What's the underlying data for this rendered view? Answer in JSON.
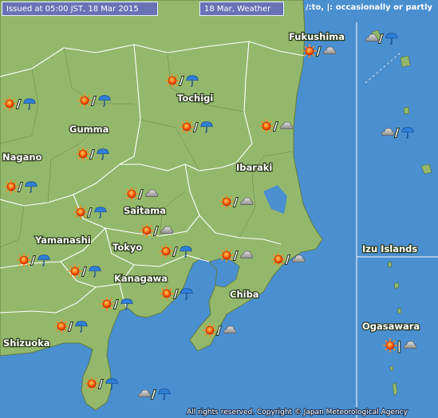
{
  "header": {
    "issued": "Issued at 05:00 JST, 18 Mar 2015",
    "date_label": "18 Mar, Weather",
    "legend": "/:to, |: occasionally or partly"
  },
  "labels": {
    "fukushima": "Fukushima",
    "tochigi": "Tochigi",
    "gumma": "Gumma",
    "nagano": "Nagano",
    "ibaraki": "Ibaraki",
    "saitama": "Saitama",
    "yamanashi": "Yamanashi",
    "tokyo": "Tokyo",
    "kanagawa": "Kanagawa",
    "chiba": "Chiba",
    "shizuoka": "Shizuoka",
    "izu": "Izu Islands",
    "ogasawara": "Ogasawara"
  },
  "footer": "All rights reserved. Copyright © Japan Meteorological Agency",
  "colors": {
    "sea": "#4a8fd0",
    "land": "#93b86b",
    "border": "#ffffff",
    "header_bg": "#6a72b6"
  },
  "forecasts": [
    {
      "area": "Fukushima",
      "from": "sun",
      "sep": "/",
      "to": "cloud"
    },
    {
      "area": "Izu north",
      "from": "cloud",
      "sep": "/",
      "to": "rain"
    },
    {
      "area": "Izu mid",
      "from": "cloud",
      "sep": "/",
      "to": "rain"
    },
    {
      "area": "Nagano north",
      "from": "sun",
      "sep": "/",
      "to": "rain"
    },
    {
      "area": "Gumma north",
      "from": "sun",
      "sep": "/",
      "to": "rain"
    },
    {
      "area": "Tochigi north",
      "from": "sun",
      "sep": "/",
      "to": "rain"
    },
    {
      "area": "Tochigi south",
      "from": "sun",
      "sep": "/",
      "to": "rain"
    },
    {
      "area": "Ibaraki north",
      "from": "sun",
      "sep": "/",
      "to": "cloud"
    },
    {
      "area": "Gumma south",
      "from": "sun",
      "sep": "/",
      "to": "rain"
    },
    {
      "area": "Nagano south",
      "from": "sun",
      "sep": "/",
      "to": "rain"
    },
    {
      "area": "Saitama north",
      "from": "sun",
      "sep": "/",
      "to": "cloud"
    },
    {
      "area": "Saitama west",
      "from": "sun",
      "sep": "/",
      "to": "rain"
    },
    {
      "area": "Ibaraki south",
      "from": "sun",
      "sep": "/",
      "to": "cloud"
    },
    {
      "area": "Saitama south",
      "from": "sun",
      "sep": "/",
      "to": "cloud"
    },
    {
      "area": "Yamanashi",
      "from": "sun",
      "sep": "/",
      "to": "rain"
    },
    {
      "area": "Yamanashi east",
      "from": "sun",
      "sep": "/",
      "to": "rain"
    },
    {
      "area": "Tokyo",
      "from": "sun",
      "sep": "/",
      "to": "rain"
    },
    {
      "area": "Tokyo bay",
      "from": "sun",
      "sep": "/",
      "to": "cloud"
    },
    {
      "area": "Chiba north",
      "from": "sun",
      "sep": "/",
      "to": "cloud"
    },
    {
      "area": "Kanagawa",
      "from": "sun",
      "sep": "/",
      "to": "rain"
    },
    {
      "area": "Kanagawa west",
      "from": "sun",
      "sep": "/",
      "to": "rain"
    },
    {
      "area": "Shizuoka east",
      "from": "sun",
      "sep": "/",
      "to": "rain"
    },
    {
      "area": "Chiba south",
      "from": "sun",
      "sep": "/",
      "to": "cloud"
    },
    {
      "area": "Izu peninsula",
      "from": "sun",
      "sep": "/",
      "to": "rain"
    },
    {
      "area": "Izu Islands",
      "from": "cloud",
      "sep": "/",
      "to": "rain"
    },
    {
      "area": "Ogasawara",
      "from": "sun",
      "sep": "|",
      "to": "cloud"
    }
  ]
}
